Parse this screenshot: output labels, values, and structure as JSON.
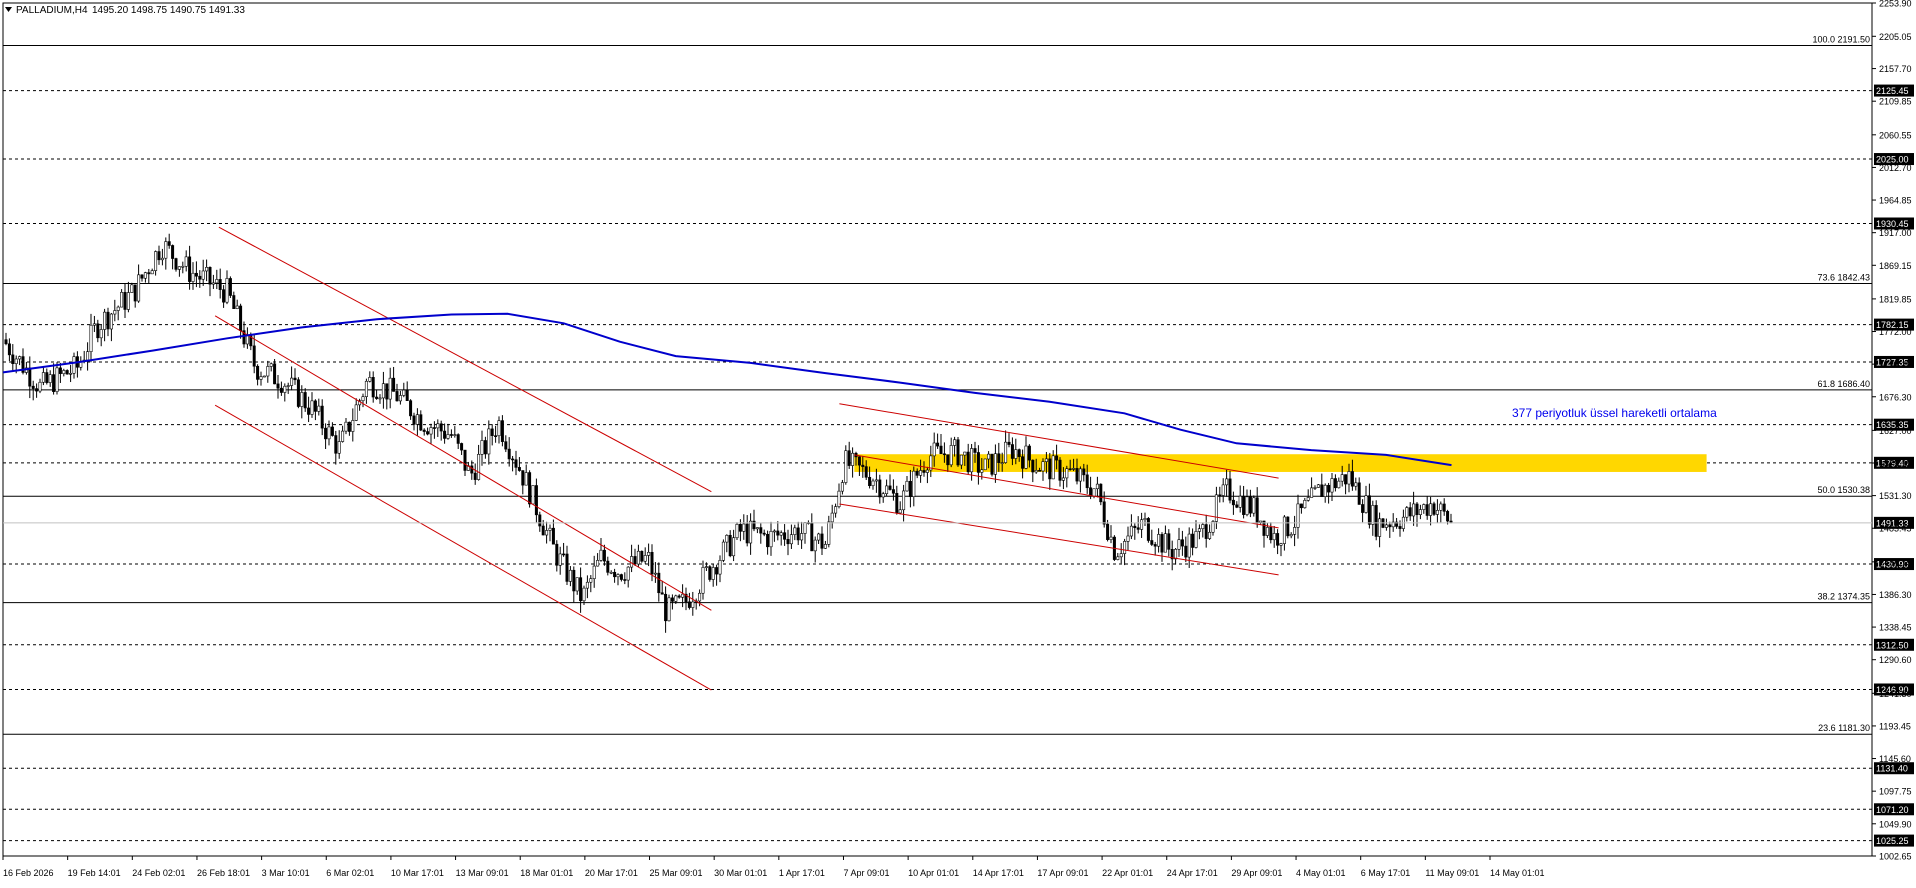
{
  "header": {
    "symbol": "PALLADIUM,H4",
    "ohlc": "1495.20 1498.75 1490.75 1491.33",
    "menu_icon": "triangle-down-icon"
  },
  "annotation": {
    "ema_label": "377 periyotluk üssel hareketli ortalama",
    "color": "#0000ee"
  },
  "chart_data": {
    "type": "candlestick",
    "title": "PALLADIUM,H4",
    "ylim": [
      1002.65,
      2253.9
    ],
    "y_axis_ticks": [
      "2253.90",
      "2205.05",
      "2157.70",
      "2109.85",
      "2060.55",
      "2012.70",
      "1964.85",
      "1917.00",
      "1869.15",
      "1819.85",
      "1772.00",
      "1724.15",
      "1676.30",
      "1627.00",
      "1579.15",
      "1531.30",
      "1483.45",
      "1434.15",
      "1386.30",
      "1338.45",
      "1290.60",
      "1241.30",
      "1193.45",
      "1145.60",
      "1097.75",
      "1049.90",
      "1002.65"
    ],
    "x_axis_labels": [
      "16 Feb 2026",
      "19 Feb 14:01",
      "24 Feb 02:01",
      "26 Feb 18:01",
      "3 Mar 10:01",
      "6 Mar 02:01",
      "10 Mar 17:01",
      "13 Mar 09:01",
      "18 Mar 01:01",
      "20 Mar 17:01",
      "25 Mar 09:01",
      "30 Mar 01:01",
      "1 Apr 17:01",
      "7 Apr 09:01",
      "10 Apr 01:01",
      "14 Apr 17:01",
      "17 Apr 09:01",
      "22 Apr 01:01",
      "24 Apr 17:01",
      "29 Apr 09:01",
      "4 May 01:01",
      "6 May 17:01",
      "11 May 09:01",
      "14 May 01:01"
    ],
    "fib_levels": [
      {
        "label": "100.0 2191.50",
        "value": 2191.5
      },
      {
        "label": "73.6 1842.43",
        "value": 1842.43
      },
      {
        "label": "61.8 1686.40",
        "value": 1686.4
      },
      {
        "label": "50.0 1530.38",
        "value": 1530.38
      },
      {
        "label": "38.2 1374.35",
        "value": 1374.35
      },
      {
        "label": "23.6 1181.30",
        "value": 1181.3
      }
    ],
    "horizontal_levels": [
      {
        "label": "2125.45",
        "value": 2125.45
      },
      {
        "label": "2025.00",
        "value": 2025.0
      },
      {
        "label": "1930.45",
        "value": 1930.45
      },
      {
        "label": "1782.15",
        "value": 1782.15
      },
      {
        "label": "1727.35",
        "value": 1727.35
      },
      {
        "label": "1635.35",
        "value": 1635.35
      },
      {
        "label": "1579.40",
        "value": 1579.4
      },
      {
        "label": "1430.90",
        "value": 1430.9
      },
      {
        "label": "1312.50",
        "value": 1312.5
      },
      {
        "label": "1246.90",
        "value": 1246.9
      },
      {
        "label": "1131.40",
        "value": 1131.4
      },
      {
        "label": "1071.20",
        "value": 1071.2
      },
      {
        "label": "1025.25",
        "value": 1025.25
      }
    ],
    "current_price": {
      "label": "1491.33",
      "value": 1491.33
    },
    "zone": {
      "from": 1566,
      "to": 1592,
      "color": "#ffd700",
      "x_range": [
        0.4555,
        0.9115
      ]
    },
    "channels": [
      {
        "color": "#cc0000",
        "start": [
          0.1155,
          1925
        ],
        "end": [
          0.379,
          1537
        ]
      },
      {
        "color": "#cc0000",
        "start": [
          0.1135,
          1795
        ],
        "end": [
          0.379,
          1363
        ]
      },
      {
        "color": "#cc0000",
        "start": [
          0.1135,
          1664
        ],
        "end": [
          0.379,
          1246
        ]
      },
      {
        "color": "#cc0000",
        "start": [
          0.4475,
          1666
        ],
        "end": [
          0.6825,
          1557
        ]
      },
      {
        "color": "#cc0000",
        "start": [
          0.4475,
          1519
        ],
        "end": [
          0.6825,
          1415
        ]
      },
      {
        "color": "#cc0000",
        "start": [
          0.4555,
          1591
        ],
        "end": [
          0.6825,
          1484
        ]
      }
    ],
    "ema": {
      "name": "377 periyotluk üssel hareketli ortalama",
      "color": "#0000cc",
      "points": [
        [
          0.0,
          1712
        ],
        [
          0.04,
          1727
        ],
        [
          0.08,
          1744
        ],
        [
          0.12,
          1762
        ],
        [
          0.16,
          1778
        ],
        [
          0.2,
          1790
        ],
        [
          0.24,
          1797
        ],
        [
          0.27,
          1798
        ],
        [
          0.3,
          1784
        ],
        [
          0.33,
          1757
        ],
        [
          0.36,
          1736
        ],
        [
          0.4,
          1726
        ],
        [
          0.44,
          1711
        ],
        [
          0.48,
          1697
        ],
        [
          0.52,
          1682
        ],
        [
          0.56,
          1669
        ],
        [
          0.6,
          1652
        ],
        [
          0.63,
          1628
        ],
        [
          0.66,
          1608
        ],
        [
          0.7,
          1598
        ],
        [
          0.74,
          1591
        ],
        [
          0.775,
          1576
        ]
      ]
    },
    "price_path": [
      [
        0.0,
        1760
      ],
      [
        0.02,
        1690
      ],
      [
        0.04,
        1720
      ],
      [
        0.05,
        1780
      ],
      [
        0.07,
        1830
      ],
      [
        0.085,
        1900
      ],
      [
        0.1,
        1860
      ],
      [
        0.12,
        1830
      ],
      [
        0.135,
        1720
      ],
      [
        0.15,
        1700
      ],
      [
        0.165,
        1660
      ],
      [
        0.18,
        1600
      ],
      [
        0.195,
        1700
      ],
      [
        0.21,
        1680
      ],
      [
        0.225,
        1640
      ],
      [
        0.24,
        1620
      ],
      [
        0.25,
        1560
      ],
      [
        0.265,
        1640
      ],
      [
        0.28,
        1550
      ],
      [
        0.295,
        1450
      ],
      [
        0.31,
        1380
      ],
      [
        0.32,
        1440
      ],
      [
        0.33,
        1420
      ],
      [
        0.345,
        1440
      ],
      [
        0.355,
        1360
      ],
      [
        0.365,
        1375
      ],
      [
        0.38,
        1430
      ],
      [
        0.395,
        1480
      ],
      [
        0.41,
        1470
      ],
      [
        0.425,
        1480
      ],
      [
        0.44,
        1460
      ],
      [
        0.45,
        1580
      ],
      [
        0.465,
        1560
      ],
      [
        0.48,
        1520
      ],
      [
        0.495,
        1590
      ],
      [
        0.51,
        1595
      ],
      [
        0.525,
        1570
      ],
      [
        0.54,
        1600
      ],
      [
        0.555,
        1575
      ],
      [
        0.57,
        1565
      ],
      [
        0.585,
        1540
      ],
      [
        0.595,
        1450
      ],
      [
        0.61,
        1490
      ],
      [
        0.625,
        1450
      ],
      [
        0.64,
        1470
      ],
      [
        0.655,
        1540
      ],
      [
        0.67,
        1510
      ],
      [
        0.68,
        1470
      ],
      [
        0.69,
        1490
      ],
      [
        0.705,
        1540
      ],
      [
        0.72,
        1560
      ],
      [
        0.735,
        1490
      ],
      [
        0.75,
        1500
      ],
      [
        0.765,
        1520
      ],
      [
        0.775,
        1491.33
      ]
    ]
  }
}
